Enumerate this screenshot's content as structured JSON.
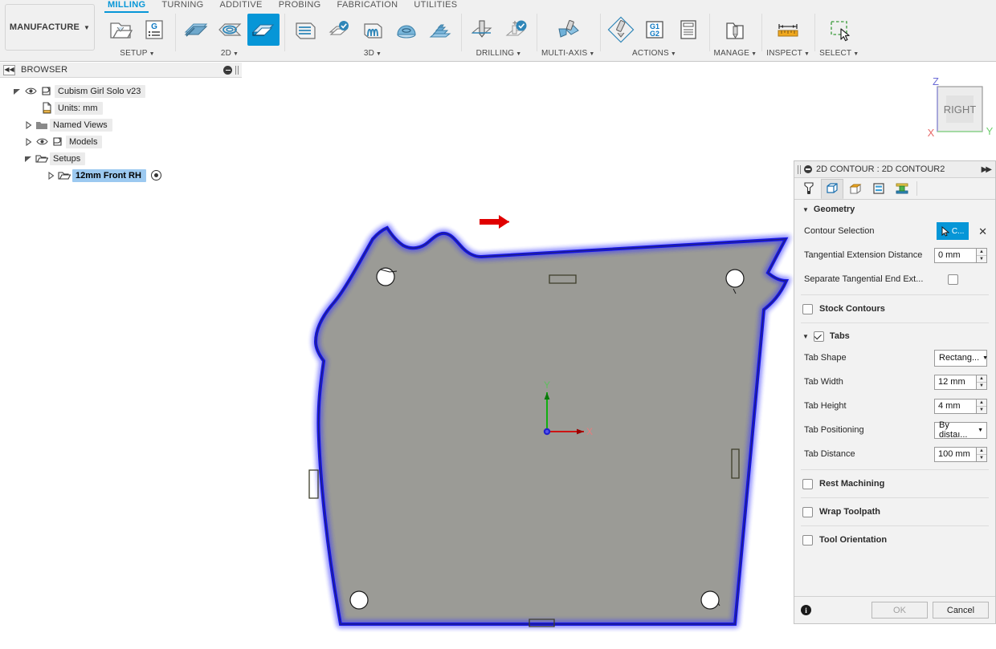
{
  "toolbar": {
    "workspace_label": "MANUFACTURE",
    "tabs": [
      {
        "label": "MILLING",
        "active": true
      },
      {
        "label": "TURNING",
        "active": false
      },
      {
        "label": "ADDITIVE",
        "active": false
      },
      {
        "label": "PROBING",
        "active": false
      },
      {
        "label": "FABRICATION",
        "active": false
      },
      {
        "label": "UTILITIES",
        "active": false
      }
    ],
    "groups": [
      {
        "label": "SETUP",
        "has_caret": true,
        "icons": [
          "setup-folder-icon",
          "g-code-list-icon"
        ]
      },
      {
        "label": "2D",
        "has_caret": true,
        "icons": [
          "face-icon",
          "2d-adaptive-icon",
          "2d-contour-icon"
        ]
      },
      {
        "label": "3D",
        "has_caret": true,
        "icons": [
          "3d-adaptive-icon",
          "3d-pocket-icon",
          "parallel-icon",
          "scallop-icon",
          "radial-icon"
        ]
      },
      {
        "label": "DRILLING",
        "has_caret": true,
        "icons": [
          "drill-icon",
          "drill-add-icon"
        ]
      },
      {
        "label": "MULTI-AXIS",
        "has_caret": true,
        "icons": [
          "multi-axis-icon"
        ]
      },
      {
        "label": "ACTIONS",
        "has_caret": true,
        "icons": [
          "simulate-icon",
          "post-process-icon",
          "setup-sheet-icon"
        ]
      },
      {
        "label": "MANAGE",
        "has_caret": true,
        "icons": [
          "tool-library-icon"
        ]
      },
      {
        "label": "INSPECT",
        "has_caret": true,
        "icons": [
          "measure-icon"
        ]
      },
      {
        "label": "SELECT",
        "has_caret": true,
        "icons": [
          "select-window-icon"
        ]
      }
    ]
  },
  "browser": {
    "title": "BROWSER",
    "collapse_icon": "collapse-left-icon",
    "minimize_icon": "minus-circle-icon",
    "items": [
      {
        "label": "Cubism Girl Solo v23",
        "indent": 0,
        "twist": "down",
        "eye": true,
        "icon": "document-icon",
        "selected": false
      },
      {
        "label": "Units: mm",
        "indent": 1,
        "twist": "none",
        "eye": false,
        "icon": "units-icon",
        "selected": false
      },
      {
        "label": "Named Views",
        "indent": 1,
        "twist": "right",
        "eye": false,
        "icon": "folder-icon",
        "selected": false
      },
      {
        "label": "Models",
        "indent": 1,
        "twist": "right",
        "eye": true,
        "icon": "component-icon",
        "selected": false
      },
      {
        "label": "Setups",
        "indent": 1,
        "twist": "down",
        "eye": false,
        "icon": "open-folder-icon",
        "selected": false
      },
      {
        "label": "12mm Front RH",
        "indent": 2,
        "twist": "right",
        "eye": false,
        "icon": "open-folder-icon",
        "selected": true,
        "suppress_icon": "target-dot-icon"
      }
    ]
  },
  "viewcube": {
    "face_label": "RIGHT",
    "axis_z": "Z",
    "axis_x": "X",
    "axis_y": "Y",
    "color_z": "#6b6bd6",
    "color_x": "#e86a6a",
    "color_y": "#6fcf6f"
  },
  "canvas": {
    "origin_axis_x": "X",
    "origin_axis_y": "Y",
    "body_color": "#9b9b96",
    "contour_color": "#1414e6",
    "contour_glow": "#3a3aff",
    "direction_arrow_color": "#e00000",
    "hole_color": "#ffffff"
  },
  "panel": {
    "title": "2D CONTOUR : 2D CONTOUR2",
    "expand_icon": "expand-right-icon",
    "tabs": [
      {
        "name": "tool-tab",
        "label": "Tool",
        "active": false
      },
      {
        "name": "geometry-tab",
        "label": "Geometry",
        "active": true
      },
      {
        "name": "heights-tab",
        "label": "Heights",
        "active": false
      },
      {
        "name": "passes-tab",
        "label": "Passes",
        "active": false
      },
      {
        "name": "linking-tab",
        "label": "Linking",
        "active": false
      }
    ],
    "geometry": {
      "section_label": "Geometry",
      "expanded": true,
      "contour_selection_label": "Contour Selection",
      "contour_selection_button": "C...",
      "contour_selection_clear": "✕",
      "tangential_extension_label": "Tangential Extension Distance",
      "tangential_extension_value": "0 mm",
      "separate_tangential_label": "Separate Tangential End Ext...",
      "separate_tangential_checked": false
    },
    "stock_contours": {
      "label": "Stock Contours",
      "checked": false
    },
    "tabs_section": {
      "label": "Tabs",
      "checked": true,
      "expanded": true,
      "rows": [
        {
          "label": "Tab Shape",
          "value": "Rectang...",
          "type": "select"
        },
        {
          "label": "Tab Width",
          "value": "12 mm",
          "type": "number"
        },
        {
          "label": "Tab Height",
          "value": "4 mm",
          "type": "number"
        },
        {
          "label": "Tab Positioning",
          "value": "By distaı...",
          "type": "select"
        },
        {
          "label": "Tab Distance",
          "value": "100 mm",
          "type": "number"
        }
      ]
    },
    "rest_machining": {
      "label": "Rest Machining",
      "checked": false
    },
    "wrap_toolpath": {
      "label": "Wrap Toolpath",
      "checked": false
    },
    "tool_orientation": {
      "label": "Tool Orientation",
      "checked": false
    },
    "footer": {
      "info_icon": "info-icon",
      "info_label": "i",
      "ok_label": "OK",
      "cancel_label": "Cancel",
      "ok_enabled": false
    },
    "accent_color": "#0696d7"
  }
}
